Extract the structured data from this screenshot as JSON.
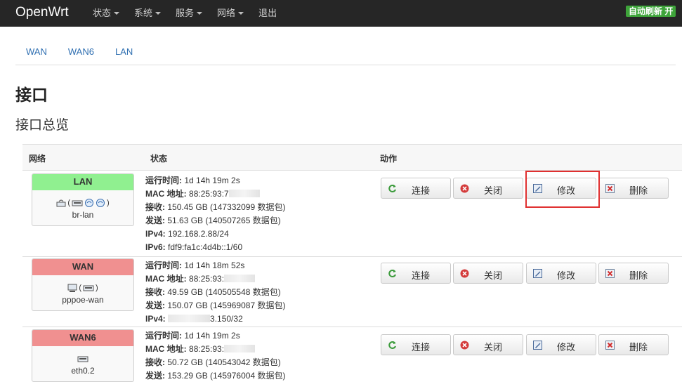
{
  "navbar": {
    "brand": "OpenWrt",
    "menu": [
      "状态",
      "系统",
      "服务",
      "网络",
      "退出"
    ],
    "auto_refresh": "自动刷新 开"
  },
  "tabs": [
    "WAN",
    "WAN6",
    "LAN"
  ],
  "page_title": "接口",
  "section_title": "接口总览",
  "table": {
    "headers": {
      "network": "网络",
      "status": "状态",
      "actions": "动作"
    },
    "actions": {
      "connect": "连接",
      "stop": "关闭",
      "edit": "修改",
      "delete": "删除"
    },
    "rows": [
      {
        "name": "LAN",
        "device": "br-lan",
        "icons": "(LAN devices)",
        "lines": [
          {
            "k": "运行时间:",
            "v": "1d 14h 19m 2s"
          },
          {
            "k": "MAC 地址:",
            "v": "88:25:93:7"
          },
          {
            "k": "接收:",
            "v": "150.45 GB (147332099 数据包)"
          },
          {
            "k": "发送:",
            "v": "51.63 GB (140507265 数据包)"
          },
          {
            "k": "IPv4:",
            "v": "192.168.2.88/24"
          },
          {
            "k": "IPv6:",
            "v": "fdf9:fa1c:4d4b::1/60"
          }
        ]
      },
      {
        "name": "WAN",
        "device": "pppoe-wan",
        "icons": "(WAN devices)",
        "lines": [
          {
            "k": "运行时间:",
            "v": "1d 14h 18m 52s"
          },
          {
            "k": "MAC 地址:",
            "v": "88:25:93:"
          },
          {
            "k": "接收:",
            "v": "49.59 GB (140505548 数据包)"
          },
          {
            "k": "发送:",
            "v": "150.07 GB (145969087 数据包)"
          },
          {
            "k": "IPv4:",
            "v": "3.150/32"
          }
        ]
      },
      {
        "name": "WAN6",
        "device": "eth0.2",
        "icons": "(WAN6 device)",
        "lines": [
          {
            "k": "运行时间:",
            "v": "1d 14h 19m 2s"
          },
          {
            "k": "MAC 地址:",
            "v": "88:25:93:"
          },
          {
            "k": "接收:",
            "v": "50.72 GB (140543042 数据包)"
          },
          {
            "k": "发送:",
            "v": "153.29 GB (145976004 数据包)"
          }
        ]
      }
    ]
  },
  "colors": {
    "up": "#90f090",
    "down": "#f09090",
    "link": "#2f6fb1",
    "highlight": "#e03030"
  }
}
